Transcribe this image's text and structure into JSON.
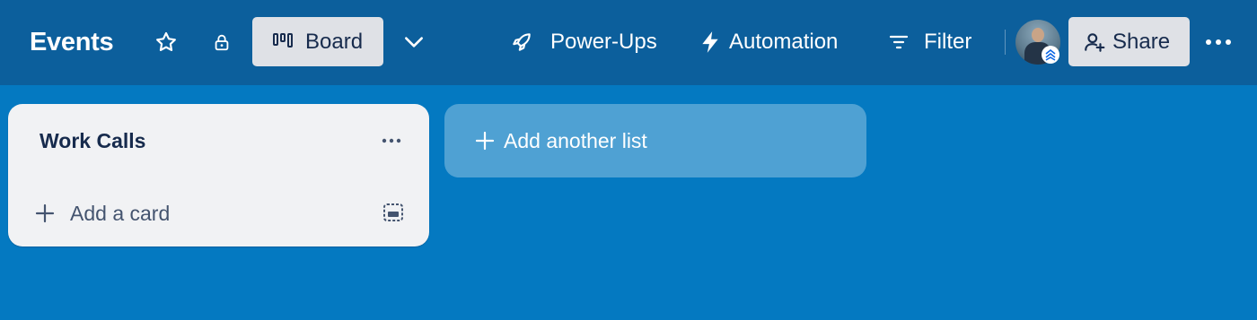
{
  "header": {
    "board_title": "Events",
    "view_label": "Board",
    "power_ups_label": "Power-Ups",
    "automation_label": "Automation",
    "filter_label": "Filter",
    "share_label": "Share"
  },
  "lists": [
    {
      "title": "Work Calls",
      "add_card_label": "Add a card"
    }
  ],
  "add_list_label": "Add another list",
  "colors": {
    "header_bg": "#0c5f9c",
    "board_bg": "#0479c1",
    "list_bg": "#f1f2f4",
    "button_bg": "#dfe1e6",
    "text_dark": "#172b4d"
  },
  "icons": [
    "star-icon",
    "lock-icon",
    "board-icon",
    "chevron-down-icon",
    "rocket-icon",
    "lightning-icon",
    "filter-icon",
    "add-member-icon",
    "more-icon",
    "plus-icon",
    "template-icon"
  ]
}
